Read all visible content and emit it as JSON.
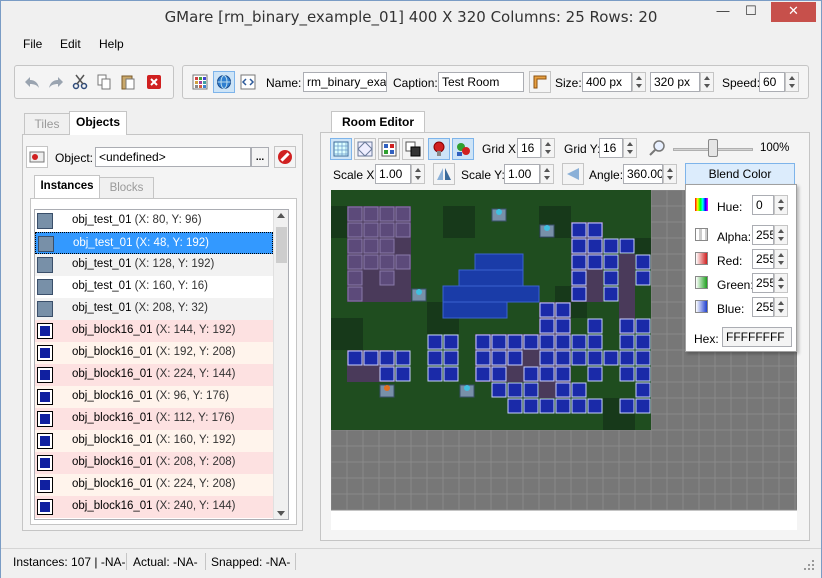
{
  "window": {
    "title": "GMare [rm_binary_example_01] 400 X 320 Columns: 25 Rows: 20",
    "min_label": "—",
    "max_label": "☐",
    "close_label": "✕"
  },
  "menu": {
    "file": "File",
    "edit": "Edit",
    "help": "Help"
  },
  "toolbar": {
    "name_label": "Name:",
    "name_value": "rm_binary_examp",
    "caption_label": "Caption:",
    "caption_value": "Test Room",
    "size_label": "Size:",
    "width_value": "400 px",
    "height_value": "320 px",
    "speed_label": "Speed:",
    "speed_value": "60"
  },
  "left_panel": {
    "tabs": [
      "Tiles",
      "Objects"
    ],
    "active_tab": "Objects",
    "object_label": "Object:",
    "object_value": "<undefined>",
    "browse_label": "...",
    "sub_tabs": [
      "Instances",
      "Blocks"
    ],
    "active_sub_tab": "Instances",
    "instances": [
      {
        "name": "obj_test_01",
        "coords": "(X: 80, Y: 96)",
        "kind": "test",
        "state": "normal"
      },
      {
        "name": "obj_test_01",
        "coords": "(X: 48, Y: 192)",
        "kind": "test",
        "state": "selected"
      },
      {
        "name": "obj_test_01",
        "coords": "(X: 128, Y: 192)",
        "kind": "test",
        "state": "alt"
      },
      {
        "name": "obj_test_01",
        "coords": "(X: 160, Y: 16)",
        "kind": "test",
        "state": "normal"
      },
      {
        "name": "obj_test_01",
        "coords": "(X: 208, Y: 32)",
        "kind": "test",
        "state": "alt"
      },
      {
        "name": "obj_block16_01",
        "coords": "(X: 144, Y: 192)",
        "kind": "block",
        "state": "pink"
      },
      {
        "name": "obj_block16_01",
        "coords": "(X: 192, Y: 208)",
        "kind": "block",
        "state": "cream"
      },
      {
        "name": "obj_block16_01",
        "coords": "(X: 224, Y: 144)",
        "kind": "block",
        "state": "pink"
      },
      {
        "name": "obj_block16_01",
        "coords": "(X: 96, Y: 176)",
        "kind": "block",
        "state": "cream"
      },
      {
        "name": "obj_block16_01",
        "coords": "(X: 112, Y: 176)",
        "kind": "block",
        "state": "pink"
      },
      {
        "name": "obj_block16_01",
        "coords": "(X: 160, Y: 192)",
        "kind": "block",
        "state": "cream"
      },
      {
        "name": "obj_block16_01",
        "coords": "(X: 208, Y: 208)",
        "kind": "block",
        "state": "pink"
      },
      {
        "name": "obj_block16_01",
        "coords": "(X: 224, Y: 208)",
        "kind": "block",
        "state": "cream"
      },
      {
        "name": "obj_block16_01",
        "coords": "(X: 240, Y: 144)",
        "kind": "block",
        "state": "pink"
      }
    ]
  },
  "room_editor": {
    "tab": "Room Editor",
    "grid_x_label": "Grid X:",
    "grid_x_value": "16",
    "grid_y_label": "Grid Y:",
    "grid_y_value": "16",
    "zoom_value": "100%",
    "zoom_level": 0.5,
    "scale_x_label": "Scale X:",
    "scale_x_value": "1.00",
    "scale_y_label": "Scale Y:",
    "scale_y_value": "1.00",
    "angle_label": "Angle:",
    "angle_value": "360.00",
    "blend_button": "Blend Color"
  },
  "blend_popup": {
    "hue_label": "Hue:",
    "hue_value": "0",
    "alpha_label": "Alpha:",
    "alpha_value": "255",
    "red_label": "Red:",
    "red_value": "255",
    "green_label": "Green:",
    "green_value": "255",
    "blue_label": "Blue:",
    "blue_value": "255",
    "hex_label": "Hex:",
    "hex_value": "FFFFFFFF"
  },
  "status": {
    "instances": "Instances: 107 | -NA-",
    "actual": "Actual: -NA-",
    "snapped": "Snapped: -NA-"
  },
  "colors": {
    "grass": "#1f4d1f",
    "water": "#1a3ca8",
    "block": "#1a2aa8",
    "stone": "#4a3a5a",
    "empty_grid": "#777777",
    "selection": "#3399ff"
  }
}
